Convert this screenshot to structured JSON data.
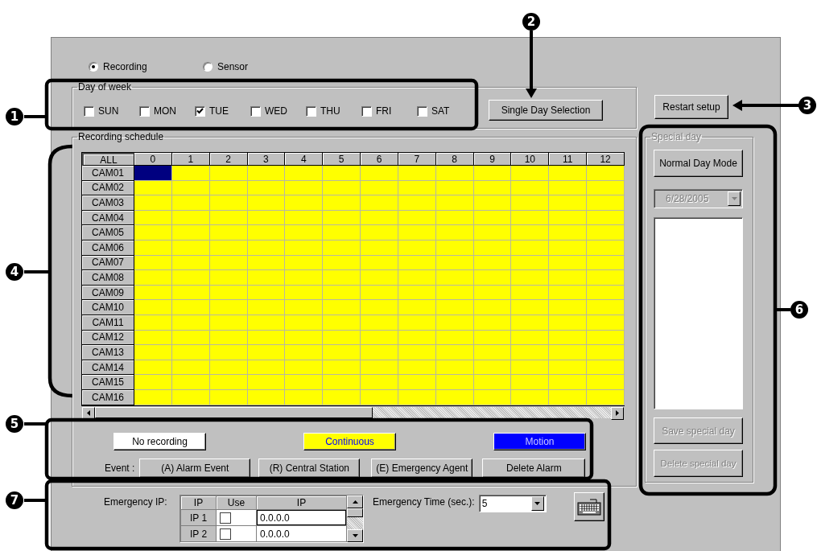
{
  "mode_options": [
    {
      "label": "Recording",
      "selected": true
    },
    {
      "label": "Sensor",
      "selected": false
    }
  ],
  "day_of_week": {
    "title": "Day of week",
    "days": [
      {
        "label": "SUN",
        "checked": false
      },
      {
        "label": "MON",
        "checked": false
      },
      {
        "label": "TUE",
        "checked": true
      },
      {
        "label": "WED",
        "checked": false
      },
      {
        "label": "THU",
        "checked": false
      },
      {
        "label": "FRI",
        "checked": false
      },
      {
        "label": "SAT",
        "checked": false
      }
    ],
    "single_day_button": "Single Day Selection"
  },
  "restart_button": "Restart setup",
  "schedule": {
    "title": "Recording schedule",
    "corner": "ALL",
    "columns": [
      {
        "label": "0",
        "selected": true
      },
      {
        "label": "1",
        "selected": false
      },
      {
        "label": "2",
        "selected": false
      },
      {
        "label": "3",
        "selected": false
      },
      {
        "label": "4",
        "selected": false
      },
      {
        "label": "5",
        "selected": false
      },
      {
        "label": "6",
        "selected": false
      },
      {
        "label": "7",
        "selected": false
      },
      {
        "label": "8",
        "selected": false
      },
      {
        "label": "9",
        "selected": false
      },
      {
        "label": "10",
        "selected": false
      },
      {
        "label": "11",
        "selected": false
      },
      {
        "label": "12",
        "selected": false
      }
    ],
    "rows": [
      {
        "label": "CAM01",
        "kind": "continuous",
        "selected": true
      },
      {
        "label": "CAM02",
        "kind": "continuous",
        "selected": false
      },
      {
        "label": "CAM03",
        "kind": "continuous",
        "selected": false
      },
      {
        "label": "CAM04",
        "kind": "continuous",
        "selected": false
      },
      {
        "label": "CAM05",
        "kind": "continuous",
        "selected": false
      },
      {
        "label": "CAM06",
        "kind": "continuous",
        "selected": false
      },
      {
        "label": "CAM07",
        "kind": "continuous",
        "selected": false
      },
      {
        "label": "CAM08",
        "kind": "continuous",
        "selected": false
      },
      {
        "label": "CAM09",
        "kind": "continuous",
        "selected": false
      },
      {
        "label": "CAM10",
        "kind": "continuous",
        "selected": false
      },
      {
        "label": "CAM11",
        "kind": "continuous",
        "selected": false
      },
      {
        "label": "CAM12",
        "kind": "continuous",
        "selected": false
      },
      {
        "label": "CAM13",
        "kind": "continuous",
        "selected": false
      },
      {
        "label": "CAM14",
        "kind": "continuous",
        "selected": false
      },
      {
        "label": "CAM15",
        "kind": "continuous",
        "selected": false
      },
      {
        "label": "CAM16",
        "kind": "continuous",
        "selected": false
      }
    ]
  },
  "legend": [
    {
      "label": "No recording",
      "kind": "none"
    },
    {
      "label": "Continuous",
      "kind": "continuous"
    },
    {
      "label": "Motion",
      "kind": "motion"
    }
  ],
  "event_label": "Event :",
  "event_buttons": [
    "(A) Alarm Event",
    "(R) Central Station",
    "(E) Emergency Agent",
    "Delete Alarm"
  ],
  "special_day": {
    "title": "Special day",
    "disabled": true,
    "mode_button": "Normal Day Mode",
    "date": "6/28/2005",
    "save_button": "Save special day",
    "delete_button": "Delete special day"
  },
  "emergency": {
    "label": "Emergency IP:",
    "columns": [
      "IP",
      "Use",
      "IP"
    ],
    "rows": [
      {
        "label": "IP 1",
        "use": false,
        "ip": "0.0.0.0"
      },
      {
        "label": "IP 2",
        "use": false,
        "ip": "0.0.0.0"
      }
    ],
    "time_label": "Emergency Time (sec.):",
    "time_value": "5"
  },
  "callouts": [
    {
      "number": "1",
      "kind": "box"
    },
    {
      "number": "2",
      "kind": "arrow"
    },
    {
      "number": "3",
      "kind": "arrow"
    },
    {
      "number": "4",
      "kind": "bracket"
    },
    {
      "number": "5",
      "kind": "box"
    },
    {
      "number": "6",
      "kind": "box"
    },
    {
      "number": "7",
      "kind": "box"
    }
  ]
}
